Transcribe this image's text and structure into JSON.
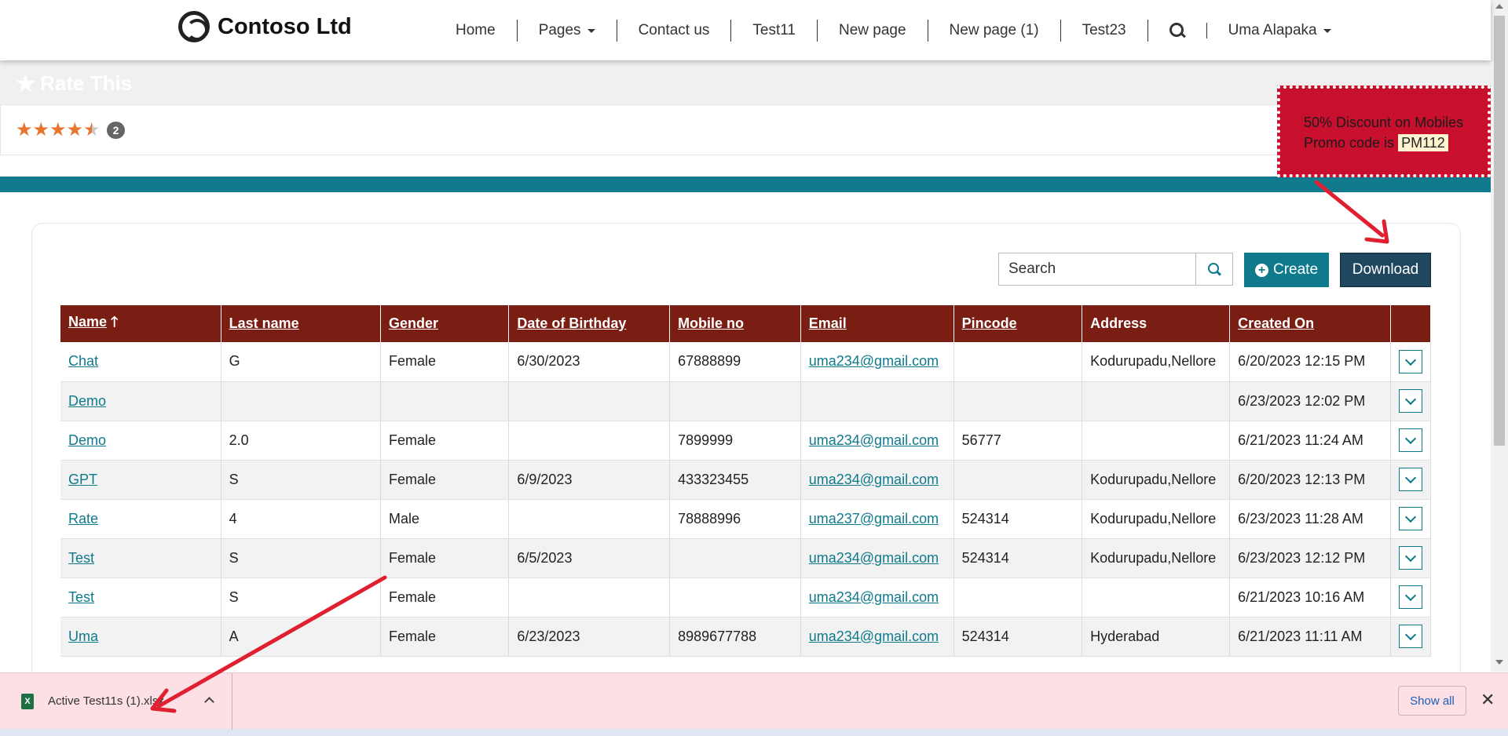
{
  "navbar": {
    "brand": "Contoso Ltd",
    "items": [
      {
        "label": "Home"
      },
      {
        "label": "Pages"
      },
      {
        "label": "Contact us"
      },
      {
        "label": "Test11"
      },
      {
        "label": "New page"
      },
      {
        "label": "New page (1)"
      },
      {
        "label": "Test23"
      }
    ],
    "user": "Uma Alapaka",
    "icons": {
      "search": "search-icon",
      "caret": "chevron-down-icon"
    }
  },
  "rate": {
    "title": "Rate This",
    "rating": 4.5,
    "max_rating": 5,
    "count": "2",
    "star_color": "#e8742e"
  },
  "promo": {
    "line1": "50% Discount on Mobiles",
    "line2_prefix": "Promo code is",
    "code": "PM112",
    "bg_color": "#c8102e"
  },
  "toolbar": {
    "search_placeholder": "Search",
    "create_label": "Create",
    "download_label": "Download"
  },
  "table": {
    "headers": {
      "name": "Name",
      "last_name": "Last name",
      "gender": "Gender",
      "dob": "Date of Birthday",
      "mobile": "Mobile no",
      "email": "Email",
      "pincode": "Pincode",
      "address": "Address",
      "created_on": "Created On"
    },
    "rows": [
      {
        "name": "Chat",
        "last_name": "G",
        "gender": "Female",
        "dob": "6/30/2023",
        "mobile": "67888899",
        "email": "uma234@gmail.com",
        "pincode": "",
        "address": "Kodurupadu,Nellore",
        "created_on": "6/20/2023 12:15 PM"
      },
      {
        "name": "Demo",
        "last_name": "",
        "gender": "",
        "dob": "",
        "mobile": "",
        "email": "",
        "pincode": "",
        "address": "",
        "created_on": "6/23/2023 12:02 PM"
      },
      {
        "name": "Demo",
        "last_name": "2.0",
        "gender": "Female",
        "dob": "",
        "mobile": "7899999",
        "email": "uma234@gmail.com",
        "pincode": "56777",
        "address": "",
        "created_on": "6/21/2023 11:24 AM"
      },
      {
        "name": "GPT",
        "last_name": "S",
        "gender": "Female",
        "dob": "6/9/2023",
        "mobile": "433323455",
        "email": "uma234@gmail.com",
        "pincode": "",
        "address": "Kodurupadu,Nellore",
        "created_on": "6/20/2023 12:13 PM"
      },
      {
        "name": "Rate",
        "last_name": "4",
        "gender": "Male",
        "dob": "",
        "mobile": "78888996",
        "email": "uma237@gmail.com",
        "pincode": "524314",
        "address": "Kodurupadu,Nellore",
        "created_on": "6/23/2023 11:28 AM"
      },
      {
        "name": "Test",
        "last_name": "S",
        "gender": "Female",
        "dob": "6/5/2023",
        "mobile": "",
        "email": "uma234@gmail.com",
        "pincode": "524314",
        "address": "Kodurupadu,Nellore",
        "created_on": "6/23/2023 12:12 PM"
      },
      {
        "name": "Test",
        "last_name": "S",
        "gender": "Female",
        "dob": "",
        "mobile": "",
        "email": "uma234@gmail.com",
        "pincode": "",
        "address": "",
        "created_on": "6/21/2023 10:16 AM"
      },
      {
        "name": "Uma",
        "last_name": "A",
        "gender": "Female",
        "dob": "6/23/2023",
        "mobile": "8989677788",
        "email": "uma234@gmail.com",
        "pincode": "524314",
        "address": "Hyderabad",
        "created_on": "6/21/2023 11:11 AM"
      }
    ]
  },
  "download_bar": {
    "file_name": "Active Test11s (1).xlsx",
    "show_all": "Show all",
    "close": "✕",
    "file_icon": "excel-file-icon"
  },
  "colors": {
    "header_bg": "#7a1e14",
    "accent": "#0e7a8c",
    "download_btn": "#1f4760",
    "annotation_arrow": "#e02030"
  }
}
